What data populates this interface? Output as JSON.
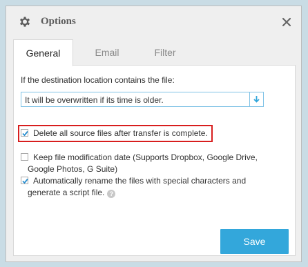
{
  "dialog": {
    "title": "Options",
    "icons": {
      "settings": "gear-icon",
      "close": "close-icon"
    }
  },
  "tabs": [
    {
      "label": "General",
      "active": true
    },
    {
      "label": "Email",
      "active": false
    },
    {
      "label": "Filter",
      "active": false
    }
  ],
  "general": {
    "destination_label": "If the destination location contains the file:",
    "overwrite_select": {
      "value": "It will be overwritten if its time is older."
    },
    "options": [
      {
        "lines": [
          "Delete all source files after transfer is complete."
        ],
        "checked": true,
        "highlighted": true
      },
      {
        "lines": [
          "Keep file modification date (Supports Dropbox, Google Drive,",
          "Google Photos, G Suite)"
        ],
        "checked": false
      },
      {
        "lines": [
          "Automatically rename the files with special characters and",
          "generate a script file."
        ],
        "checked": true,
        "help": "?"
      }
    ]
  },
  "footer": {
    "save_label": "Save"
  },
  "colors": {
    "accent": "#33a7db",
    "highlight": "#d81e1e",
    "select_border": "#7fc2e6"
  }
}
